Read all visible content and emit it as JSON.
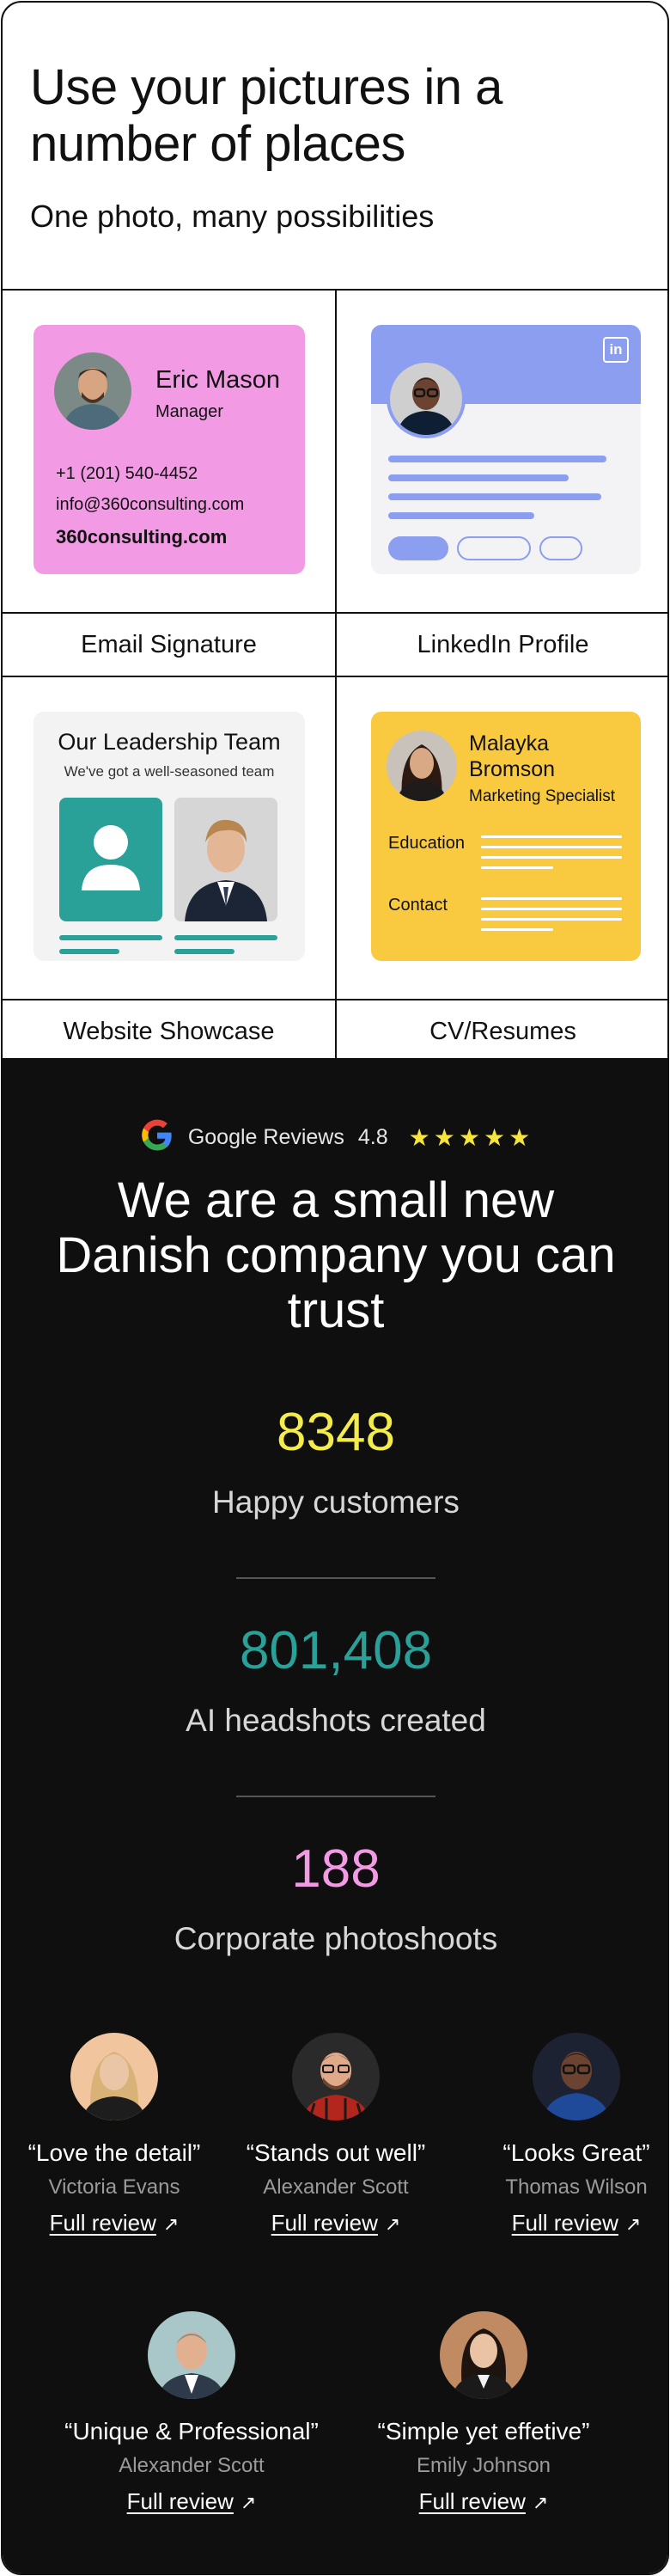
{
  "hero": {
    "title": "Use your pictures in a number of places",
    "subtitle": "One photo, many possibilities"
  },
  "cards": {
    "email_signature": {
      "caption": "Email Signature",
      "name": "Eric Mason",
      "role": "Manager",
      "phone": "+1 (201) 540-4452",
      "email": "info@360consulting.com",
      "website": "360consulting.com",
      "color": "#f29be4"
    },
    "linkedin": {
      "caption": "LinkedIn Profile",
      "logo": "in",
      "color": "#8b9ef0"
    },
    "website": {
      "caption": "Website Showcase",
      "title": "Our Leadership Team",
      "subtitle": "We've got a well-seasoned team",
      "accent": "#2aa198"
    },
    "cv": {
      "caption": "CV/Resumes",
      "name": "Malayka Bromson",
      "role": "Marketing Specialist",
      "section_education": "Education",
      "section_contact": "Contact",
      "color": "#f9c93f"
    }
  },
  "trust": {
    "reviews_label": "Google Reviews",
    "rating": "4.8",
    "stars": 5,
    "headline": "We are a small new Danish company you can trust",
    "stats": [
      {
        "value": "8348",
        "label": "Happy customers",
        "color": "#f3ec4a"
      },
      {
        "value": "801,408",
        "label": "AI headshots created",
        "color": "#2aa198"
      },
      {
        "value": "188",
        "label": "Corporate photoshoots",
        "color": "#f29be4"
      }
    ],
    "reviews": [
      {
        "quote": "“Love the detail”",
        "author": "Victoria Evans",
        "link": "Full review"
      },
      {
        "quote": "“Stands out well”",
        "author": "Alexander Scott",
        "link": "Full review"
      },
      {
        "quote": "“Looks Great”",
        "author": "Thomas Wilson",
        "link": "Full review"
      },
      {
        "quote": "“Unique & Professional”",
        "author": "Alexander Scott",
        "link": "Full review"
      },
      {
        "quote": "“Simple yet effetive”",
        "author": "Emily Johnson",
        "link": "Full review"
      }
    ]
  }
}
